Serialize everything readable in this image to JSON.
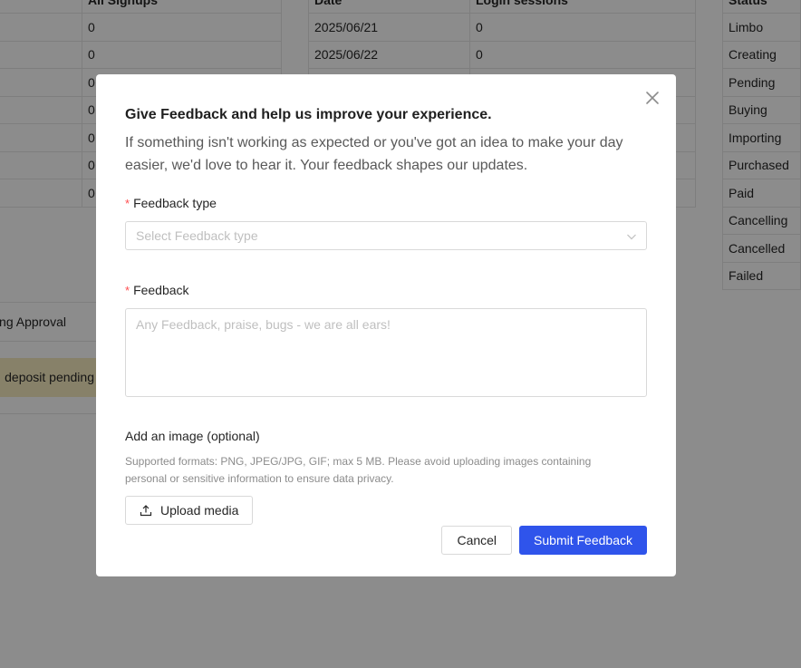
{
  "background": {
    "signups_table": {
      "header": [
        "",
        "All Signups"
      ],
      "rows": [
        "0",
        "0",
        "0",
        "0",
        "0",
        "0",
        "0"
      ]
    },
    "sessions_table": {
      "header": [
        "Date",
        "Login sessions"
      ],
      "rows": [
        [
          "2025/06/21",
          "0"
        ],
        [
          "2025/06/22",
          "0"
        ],
        [
          "",
          ""
        ],
        [
          "",
          ""
        ],
        [
          "",
          ""
        ],
        [
          "",
          ""
        ],
        [
          "",
          ""
        ]
      ]
    },
    "status_table": {
      "header": "Status",
      "rows": [
        "Limbo",
        "Creating",
        "Pending",
        "Buying",
        "Importing",
        "Purchased",
        "Paid",
        "Cancelling",
        "Cancelled",
        "Failed"
      ]
    },
    "approval_text": "ng Approval",
    "deposit_text": "deposit pending"
  },
  "modal": {
    "title": "Give Feedback and help us improve your experience.",
    "intro": "If something isn't working as expected or you've got an idea to make your day easier, we'd love to hear it. Your feedback shapes our updates.",
    "required_mark": "*",
    "type_label": "Feedback type",
    "type_placeholder": "Select Feedback type",
    "feedback_label": "Feedback",
    "feedback_placeholder": "Any Feedback, praise, bugs - we are all ears!",
    "image_label": "Add an image (optional)",
    "image_hint": "Supported formats: PNG, JPEG/JPG, GIF; max 5 MB. Please avoid uploading images containing personal or sensitive information to ensure data privacy.",
    "upload_label": "Upload media",
    "cancel_label": "Cancel",
    "submit_label": "Submit Feedback",
    "icons": {
      "close": "close-icon",
      "select": "chevron-down-icon",
      "upload": "upload-icon"
    },
    "colors": {
      "primary": "#2f54eb",
      "required": "#ff4d4f"
    }
  }
}
